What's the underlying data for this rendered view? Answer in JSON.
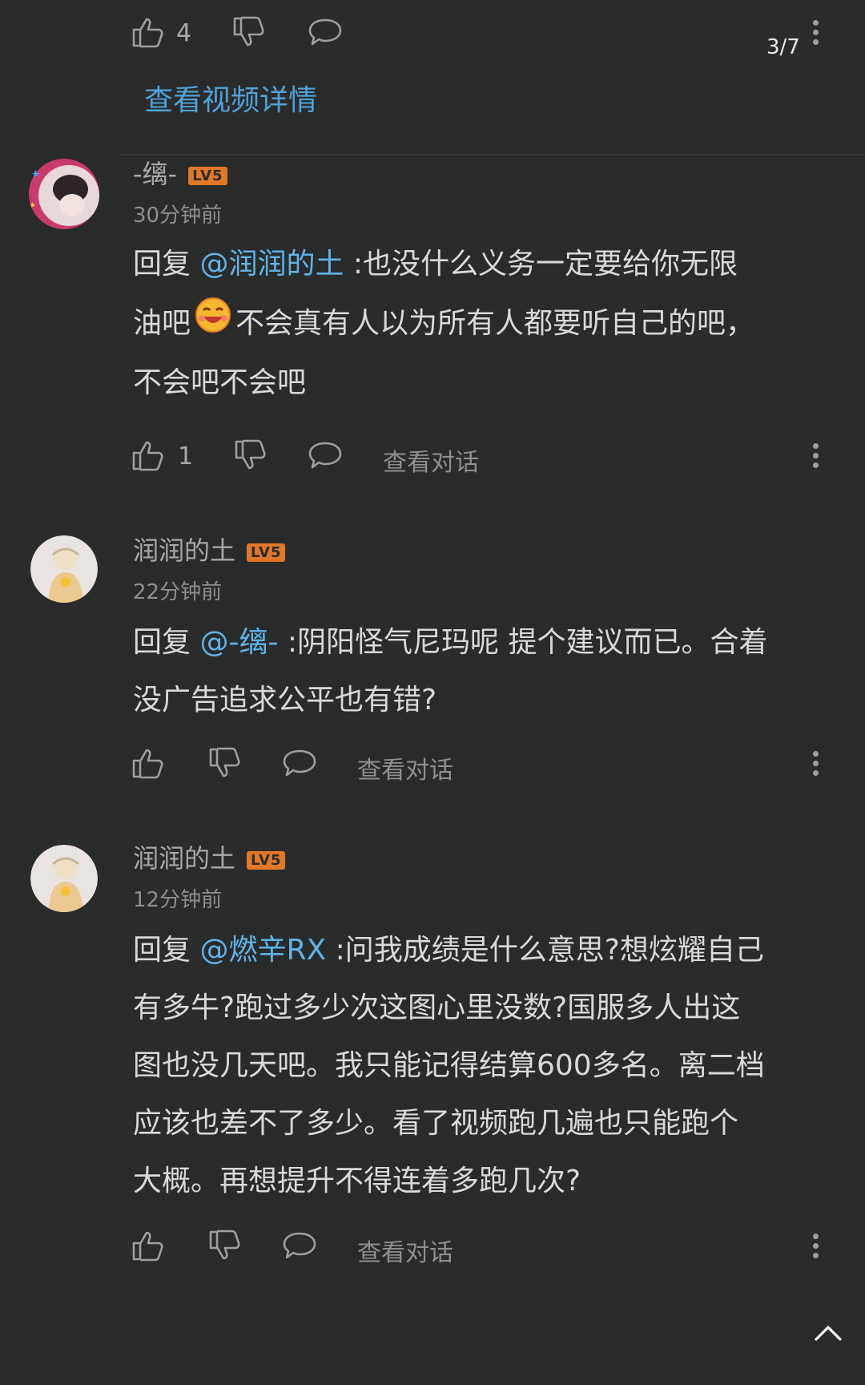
{
  "page_indicator": "3/7",
  "top_action_bar": {
    "like_count": "4"
  },
  "view_video_details": "查看视频详情",
  "comments": [
    {
      "username": "-缡-",
      "level": "LV5",
      "time": "30分钟前",
      "reply_prefix": "回复 ",
      "mention": "@润润的土",
      "line1": " :也没什么义务一定要给你无限",
      "line2_a": "油吧",
      "line2_b": "不会真有人以为所有人都要听自己的吧，",
      "line3": "不会吧不会吧",
      "like_count": "1",
      "view_thread": "查看对话"
    },
    {
      "username": "润润的土",
      "level": "LV5",
      "time": "22分钟前",
      "reply_prefix": "回复 ",
      "mention": "@-缡-",
      "line1": " :阴阳怪气尼玛呢 提个建议而已。合着",
      "line2": "没广告追求公平也有错?",
      "view_thread": "查看对话"
    },
    {
      "username": "润润的土",
      "level": "LV5",
      "time": "12分钟前",
      "reply_prefix": "回复 ",
      "mention": "@燃辛RX",
      "line1": " :问我成绩是什么意思?想炫耀自己",
      "line2": "有多牛?跑过多少次这图心里没数?国服多人出这",
      "line3": "图也没几天吧。我只能记得结算600多名。离二档",
      "line4": "应该也差不了多少。看了视频跑几遍也只能跑个",
      "line5": "大概。再想提升不得连着多跑几次?",
      "view_thread": "查看对话"
    }
  ],
  "colors": {
    "background": "#2a2b2b",
    "mention": "#5fb3e6",
    "level_badge": "#e0782a"
  }
}
